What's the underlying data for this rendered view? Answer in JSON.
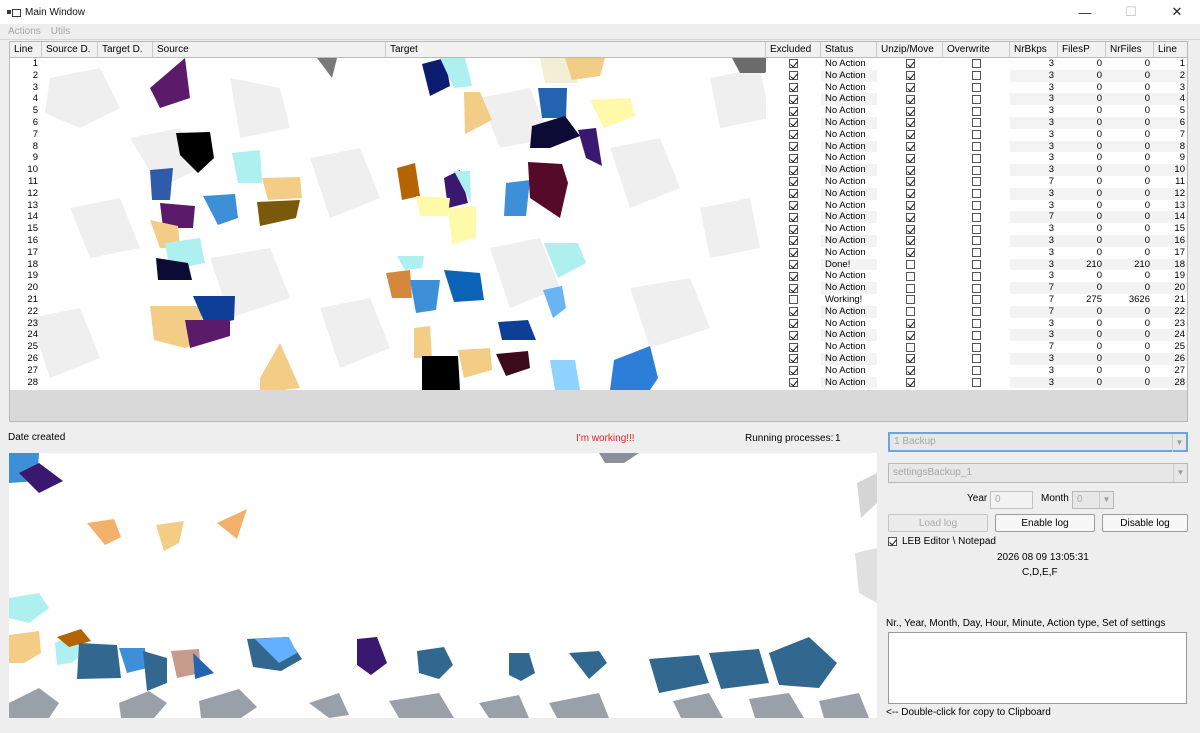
{
  "window": {
    "title": "Main Window",
    "minimize": "—",
    "maximize": "☐",
    "close": "✕"
  },
  "menu": [
    "Actions",
    "Utils"
  ],
  "table": {
    "columns": [
      "Line",
      "Source D.",
      "Target D.",
      "Source",
      "Target",
      "Excluded",
      "Status",
      "Unzip/Move",
      "Overwrite",
      "NrBkps",
      "FilesP",
      "NrFiles",
      "Line"
    ],
    "rows": [
      {
        "line": "1",
        "excluded": true,
        "status": "No Action",
        "unzip": true,
        "overwrite": false,
        "nrbkps": "3",
        "filesp": "0",
        "nrfiles": "0",
        "line2": "1"
      },
      {
        "line": "2",
        "excluded": true,
        "status": "No Action",
        "unzip": true,
        "overwrite": false,
        "nrbkps": "3",
        "filesp": "0",
        "nrfiles": "0",
        "line2": "2"
      },
      {
        "line": "3",
        "excluded": true,
        "status": "No Action",
        "unzip": true,
        "overwrite": false,
        "nrbkps": "3",
        "filesp": "0",
        "nrfiles": "0",
        "line2": "3"
      },
      {
        "line": "4",
        "excluded": true,
        "status": "No Action",
        "unzip": true,
        "overwrite": false,
        "nrbkps": "3",
        "filesp": "0",
        "nrfiles": "0",
        "line2": "4"
      },
      {
        "line": "5",
        "excluded": true,
        "status": "No Action",
        "unzip": true,
        "overwrite": false,
        "nrbkps": "3",
        "filesp": "0",
        "nrfiles": "0",
        "line2": "5"
      },
      {
        "line": "6",
        "excluded": true,
        "status": "No Action",
        "unzip": true,
        "overwrite": false,
        "nrbkps": "3",
        "filesp": "0",
        "nrfiles": "0",
        "line2": "6"
      },
      {
        "line": "7",
        "excluded": true,
        "status": "No Action",
        "unzip": true,
        "overwrite": false,
        "nrbkps": "3",
        "filesp": "0",
        "nrfiles": "0",
        "line2": "7"
      },
      {
        "line": "8",
        "excluded": true,
        "status": "No Action",
        "unzip": true,
        "overwrite": false,
        "nrbkps": "3",
        "filesp": "0",
        "nrfiles": "0",
        "line2": "8"
      },
      {
        "line": "9",
        "excluded": true,
        "status": "No Action",
        "unzip": true,
        "overwrite": false,
        "nrbkps": "3",
        "filesp": "0",
        "nrfiles": "0",
        "line2": "9"
      },
      {
        "line": "10",
        "excluded": true,
        "status": "No Action",
        "unzip": true,
        "overwrite": false,
        "nrbkps": "3",
        "filesp": "0",
        "nrfiles": "0",
        "line2": "10"
      },
      {
        "line": "11",
        "excluded": true,
        "status": "No Action",
        "unzip": true,
        "overwrite": false,
        "nrbkps": "7",
        "filesp": "0",
        "nrfiles": "0",
        "line2": "11"
      },
      {
        "line": "12",
        "excluded": true,
        "status": "No Action",
        "unzip": true,
        "overwrite": false,
        "nrbkps": "3",
        "filesp": "0",
        "nrfiles": "0",
        "line2": "12"
      },
      {
        "line": "13",
        "excluded": true,
        "status": "No Action",
        "unzip": true,
        "overwrite": false,
        "nrbkps": "3",
        "filesp": "0",
        "nrfiles": "0",
        "line2": "13"
      },
      {
        "line": "14",
        "excluded": true,
        "status": "No Action",
        "unzip": true,
        "overwrite": false,
        "nrbkps": "7",
        "filesp": "0",
        "nrfiles": "0",
        "line2": "14"
      },
      {
        "line": "15",
        "excluded": true,
        "status": "No Action",
        "unzip": true,
        "overwrite": false,
        "nrbkps": "3",
        "filesp": "0",
        "nrfiles": "0",
        "line2": "15"
      },
      {
        "line": "16",
        "excluded": true,
        "status": "No Action",
        "unzip": true,
        "overwrite": false,
        "nrbkps": "3",
        "filesp": "0",
        "nrfiles": "0",
        "line2": "16"
      },
      {
        "line": "17",
        "excluded": true,
        "status": "No Action",
        "unzip": true,
        "overwrite": false,
        "nrbkps": "3",
        "filesp": "0",
        "nrfiles": "0",
        "line2": "17"
      },
      {
        "line": "18",
        "excluded": true,
        "status": "Done!",
        "unzip": false,
        "overwrite": false,
        "nrbkps": "3",
        "filesp": "210",
        "nrfiles": "210",
        "line2": "18"
      },
      {
        "line": "19",
        "excluded": true,
        "status": "No Action",
        "unzip": false,
        "overwrite": false,
        "nrbkps": "3",
        "filesp": "0",
        "nrfiles": "0",
        "line2": "19"
      },
      {
        "line": "20",
        "excluded": true,
        "status": "No Action",
        "unzip": false,
        "overwrite": false,
        "nrbkps": "7",
        "filesp": "0",
        "nrfiles": "0",
        "line2": "20"
      },
      {
        "line": "21",
        "excluded": false,
        "status": "Working!",
        "unzip": false,
        "overwrite": false,
        "nrbkps": "7",
        "filesp": "275",
        "nrfiles": "3626",
        "line2": "21"
      },
      {
        "line": "22",
        "excluded": true,
        "status": "No Action",
        "unzip": false,
        "overwrite": false,
        "nrbkps": "7",
        "filesp": "0",
        "nrfiles": "0",
        "line2": "22"
      },
      {
        "line": "23",
        "excluded": true,
        "status": "No Action",
        "unzip": true,
        "overwrite": false,
        "nrbkps": "3",
        "filesp": "0",
        "nrfiles": "0",
        "line2": "23"
      },
      {
        "line": "24",
        "excluded": true,
        "status": "No Action",
        "unzip": true,
        "overwrite": false,
        "nrbkps": "3",
        "filesp": "0",
        "nrfiles": "0",
        "line2": "24"
      },
      {
        "line": "25",
        "excluded": true,
        "status": "No Action",
        "unzip": false,
        "overwrite": false,
        "nrbkps": "7",
        "filesp": "0",
        "nrfiles": "0",
        "line2": "25"
      },
      {
        "line": "26",
        "excluded": true,
        "status": "No Action",
        "unzip": true,
        "overwrite": false,
        "nrbkps": "3",
        "filesp": "0",
        "nrfiles": "0",
        "line2": "26"
      },
      {
        "line": "27",
        "excluded": true,
        "status": "No Action",
        "unzip": true,
        "overwrite": false,
        "nrbkps": "3",
        "filesp": "0",
        "nrfiles": "0",
        "line2": "27"
      },
      {
        "line": "28",
        "excluded": true,
        "status": "No Action",
        "unzip": true,
        "overwrite": false,
        "nrbkps": "3",
        "filesp": "0",
        "nrfiles": "0",
        "line2": "28"
      }
    ]
  },
  "status_line": {
    "date_created": "Date created",
    "working": "I'm working!!!",
    "running_label": "Running processes:",
    "running_count": "1"
  },
  "side": {
    "backup_combo": "1 Backup",
    "settings_combo": "settingsBackup_1",
    "year_label": "Year",
    "year_value": "0",
    "month_label": "Month",
    "month_value": "0",
    "load_log": "Load log",
    "enable_log": "Enable log",
    "disable_log": "Disable log",
    "editor_checkbox": "LEB Editor \\ Notepad",
    "editor_checked": true,
    "datetime": "2026 08 09 13:05:31",
    "drives": "C,D,E,F",
    "columns_hint": "Nr., Year, Month, Day, Hour, Minute, Action type, Set of settings",
    "clipboard_hint": "<-- Double-click for copy to Clipboard"
  },
  "colors": {
    "working_text": "#e0241f",
    "combo_focus": "#6aa4e6"
  }
}
